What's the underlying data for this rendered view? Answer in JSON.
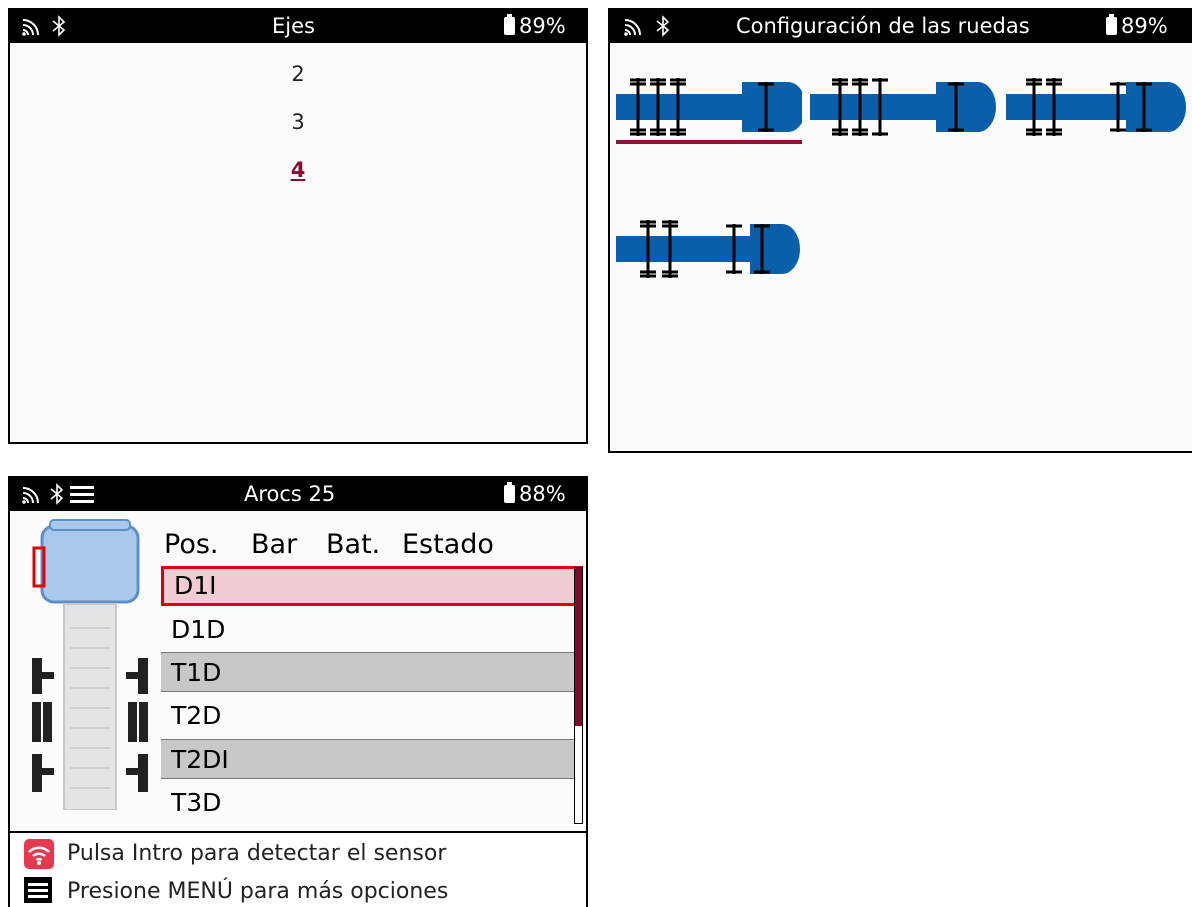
{
  "screen_axles": {
    "title": "Ejes",
    "battery": "89%",
    "options": [
      "2",
      "3",
      "4"
    ],
    "selected": "4"
  },
  "screen_wheels": {
    "title": "Configuración de las ruedas",
    "battery": "89%"
  },
  "screen_vehicle": {
    "title": "Arocs 25",
    "battery": "88%",
    "columns": [
      "Pos.",
      "Bar",
      "Bat.",
      "Estado"
    ],
    "rows": [
      "D1I",
      "D1D",
      "T1D",
      "T2D",
      "T2DI",
      "T3D"
    ],
    "hint_detect": "Pulsa Intro para detectar el sensor",
    "hint_menu": "Presione MENÚ para más opciones"
  },
  "colors": {
    "accent": "#8b1437",
    "truck_blue": "#0a5fab",
    "selection_fill": "#f2ccd3",
    "selection_border": "#d9000d"
  },
  "icons": [
    "signal-icon",
    "bluetooth-icon",
    "menu-icon",
    "battery-icon",
    "sensor-detect-icon"
  ]
}
